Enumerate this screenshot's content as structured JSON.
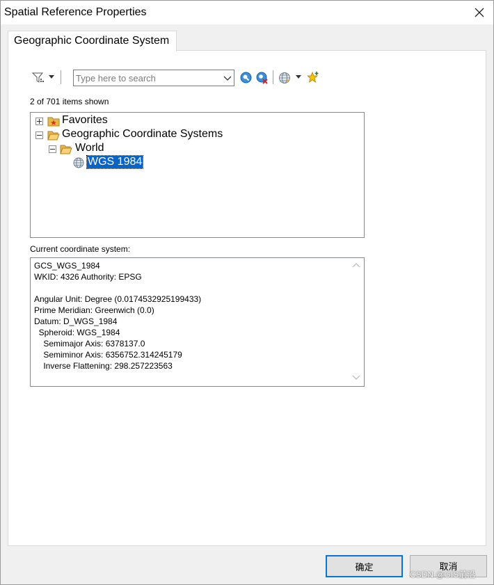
{
  "window": {
    "title": "Spatial Reference Properties"
  },
  "tabs": [
    {
      "label": "Geographic Coordinate System"
    }
  ],
  "toolbar": {
    "search_placeholder": "Type here to search",
    "icons": [
      "filter-icon",
      "dropdown-arrow-icon",
      "search-icon",
      "clear-search-icon",
      "globe-icon",
      "add-favorite-icon"
    ]
  },
  "items_count": "2 of 701 items shown",
  "tree": {
    "favorites": "Favorites",
    "geographic": "Geographic Coordinate Systems",
    "world": "World",
    "selected": "WGS 1984"
  },
  "current_label": "Current coordinate system:",
  "details": {
    "lines": [
      "GCS_WGS_1984",
      "WKID: 4326 Authority: EPSG",
      "",
      "Angular Unit: Degree (0.0174532925199433)",
      "Prime Meridian: Greenwich (0.0)",
      "Datum: D_WGS_1984",
      "  Spheroid: WGS_1984",
      "    Semimajor Axis: 6378137.0",
      "    Semiminor Axis: 6356752.314245179",
      "    Inverse Flattening: 298.257223563"
    ]
  },
  "buttons": {
    "ok": "确定",
    "cancel": "取消"
  },
  "watermark": "CSDN @GIS前沿",
  "colors": {
    "selection": "#0a64c8",
    "ok_border": "#0078d7",
    "folder": "#e8b84a"
  }
}
